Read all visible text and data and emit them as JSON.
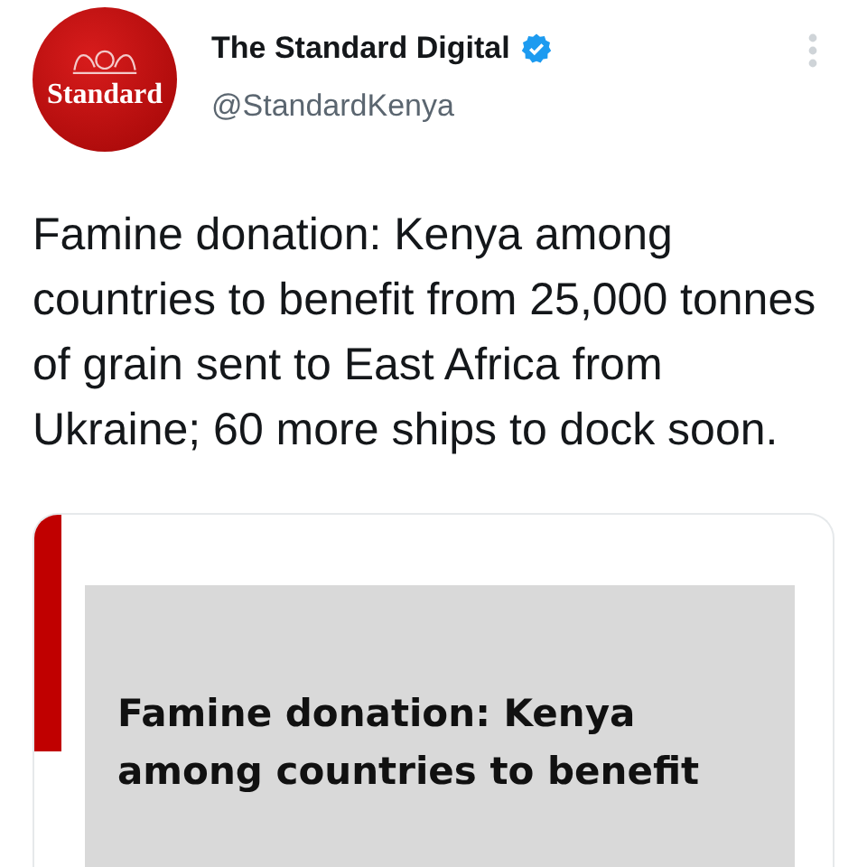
{
  "account": {
    "avatar_text": "Standard",
    "name": "The Standard Digital",
    "verified": true,
    "handle": "@StandardKenya"
  },
  "tweet": {
    "text": "Famine donation: Kenya among countries to benefit from 25,000 tonnes of grain sent to East Africa from Ukraine; 60 more ships to dock soon."
  },
  "link_card": {
    "headline": "Famine donation: Kenya among countries to benefit"
  }
}
